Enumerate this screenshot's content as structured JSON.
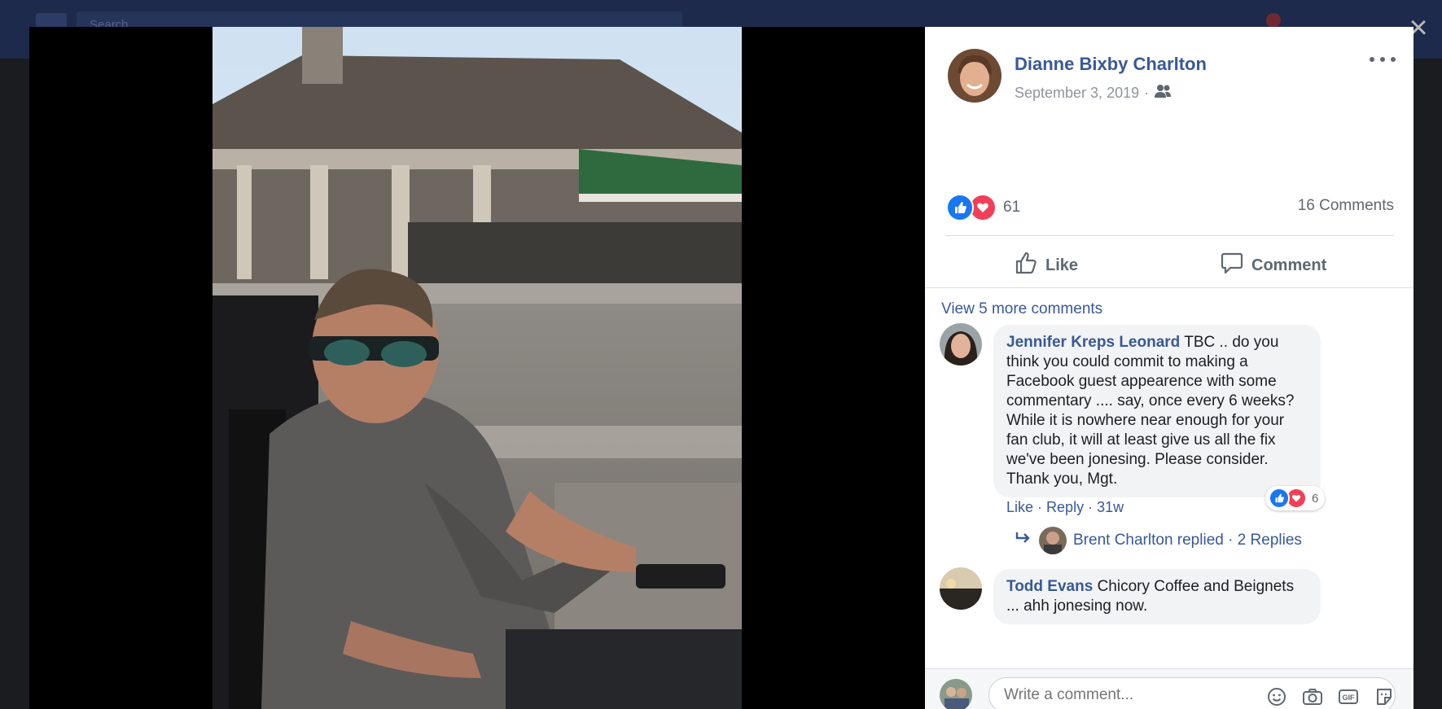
{
  "background": {
    "search_placeholder": "Search"
  },
  "post": {
    "author": "Dianne Bixby Charlton",
    "date": "September 3, 2019",
    "audience_icon": "friends-icon",
    "reaction_count": "61",
    "comments_count": "16 Comments",
    "actions": {
      "like": "Like",
      "comment": "Comment"
    }
  },
  "comments": {
    "view_more": "View 5 more comments",
    "items": [
      {
        "author": "Jennifer Kreps Leonard",
        "text": "TBC .. do you think you could commit to making a Facebook guest appearence with some commentary .... say, once every 6 weeks? While it is nowhere near enough for your fan club, it will at least give us all the fix we've been jonesing. Please consider. Thank you, Mgt.",
        "like": "Like",
        "reply": "Reply",
        "time": "31w",
        "reaction_count": "6",
        "replies_summary": "Brent Charlton replied · 2 Replies"
      },
      {
        "author": "Todd Evans",
        "text": "Chicory Coffee and Beignets ... ahh jonesing now."
      }
    ]
  },
  "composer": {
    "placeholder": "Write a comment..."
  },
  "colors": {
    "link": "#385898",
    "like_blue": "#1877f2",
    "love_red": "#f33e58"
  }
}
